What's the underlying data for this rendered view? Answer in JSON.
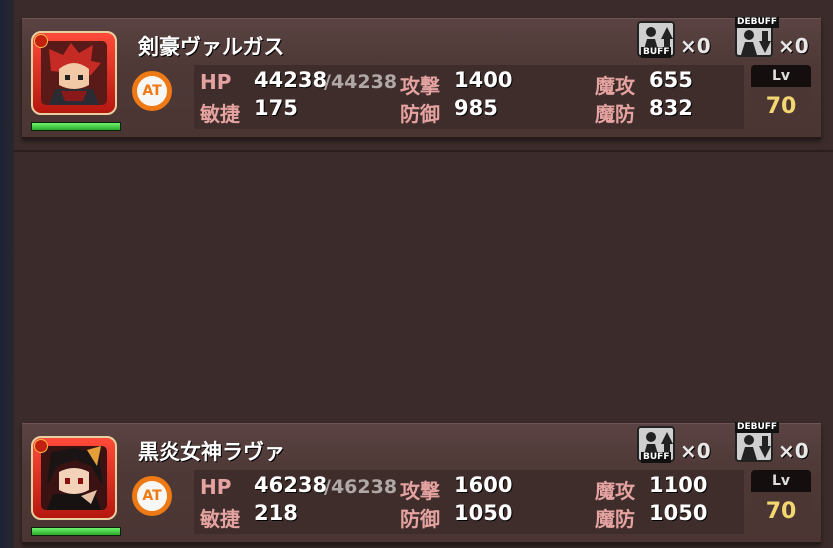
{
  "cards": [
    {
      "name": "剣豪ヴァルガス",
      "role_badge": "AT",
      "buff_tag": "BUFF",
      "buff_count": "×0",
      "debuff_tag": "DEBUFF",
      "debuff_count": "×0",
      "hp_label": "HP",
      "hp": "44238",
      "hp_max": "/44238",
      "hp_fraction": 1.0,
      "atk_label": "攻撃",
      "atk": "1400",
      "matk_label": "魔攻",
      "matk": "655",
      "agi_label": "敏捷",
      "agi": "175",
      "def_label": "防御",
      "def": "985",
      "mdef_label": "魔防",
      "mdef": "832",
      "lv_label": "Lv",
      "lv": "70",
      "element_icon": "fire-icon",
      "colors": {
        "portrait_frame": "#ff4b3a",
        "badge": "#ee7a16"
      }
    },
    {
      "name": "黒炎女神ラヴァ",
      "role_badge": "AT",
      "buff_tag": "BUFF",
      "buff_count": "×0",
      "debuff_tag": "DEBUFF",
      "debuff_count": "×0",
      "hp_label": "HP",
      "hp": "46238",
      "hp_max": "/46238",
      "hp_fraction": 1.0,
      "atk_label": "攻撃",
      "atk": "1600",
      "matk_label": "魔攻",
      "matk": "1100",
      "agi_label": "敏捷",
      "agi": "218",
      "def_label": "防御",
      "def": "1050",
      "mdef_label": "魔防",
      "mdef": "1050",
      "lv_label": "Lv",
      "lv": "70",
      "element_icon": "fire-icon",
      "colors": {
        "portrait_frame": "#ff4b3a",
        "badge": "#ee7a16"
      }
    }
  ]
}
